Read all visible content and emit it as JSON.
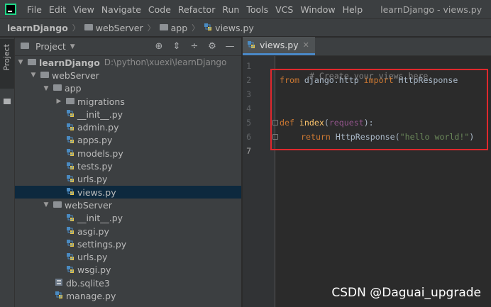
{
  "menubar": {
    "items": [
      "File",
      "Edit",
      "View",
      "Navigate",
      "Code",
      "Refactor",
      "Run",
      "Tools",
      "VCS",
      "Window",
      "Help"
    ],
    "window_title": "learnDjango - views.py"
  },
  "breadcrumb": {
    "project": "learnDjango",
    "folder1": "webServer",
    "folder2": "app",
    "file": "views.py"
  },
  "toolstripe": {
    "project_tab": "Project"
  },
  "project_panel": {
    "title": "Project",
    "tree": {
      "root": {
        "name": "learnDjango",
        "path": "D:\\python\\xuexi\\learnDjango"
      },
      "webServer_outer": "webServer",
      "app": "app",
      "migrations": "migrations",
      "app_files": [
        "__init__.py",
        "admin.py",
        "apps.py",
        "models.py",
        "tests.py",
        "urls.py",
        "views.py"
      ],
      "webServer_inner": "webServer",
      "inner_files": [
        "__init__.py",
        "asgi.py",
        "settings.py",
        "urls.py",
        "wsgi.py"
      ],
      "db": "db.sqlite3",
      "manage": "manage.py"
    }
  },
  "editor": {
    "tab_label": "views.py",
    "line_numbers": [
      "1",
      "2",
      "3",
      "4",
      "5",
      "6",
      "7"
    ],
    "code": {
      "line1_comment": "# Create your views here.",
      "line2_from": "from",
      "line2_module": " django.http ",
      "line2_import": "import",
      "line2_name": " HttpResponse",
      "line5_def": "def",
      "line5_fn": " index",
      "line5_open": "(",
      "line5_param": "request",
      "line5_close": "):",
      "line6_return": "return",
      "line6_call": " HttpResponse(",
      "line6_str": "\"hello world!\"",
      "line6_close": ")"
    }
  },
  "watermark": "CSDN @Daguai_upgrade",
  "colors": {
    "selection": "#0d293e",
    "highlight_border": "#e0282d",
    "keyword": "#cc7832",
    "string": "#6a8759",
    "function": "#ffc66d"
  }
}
